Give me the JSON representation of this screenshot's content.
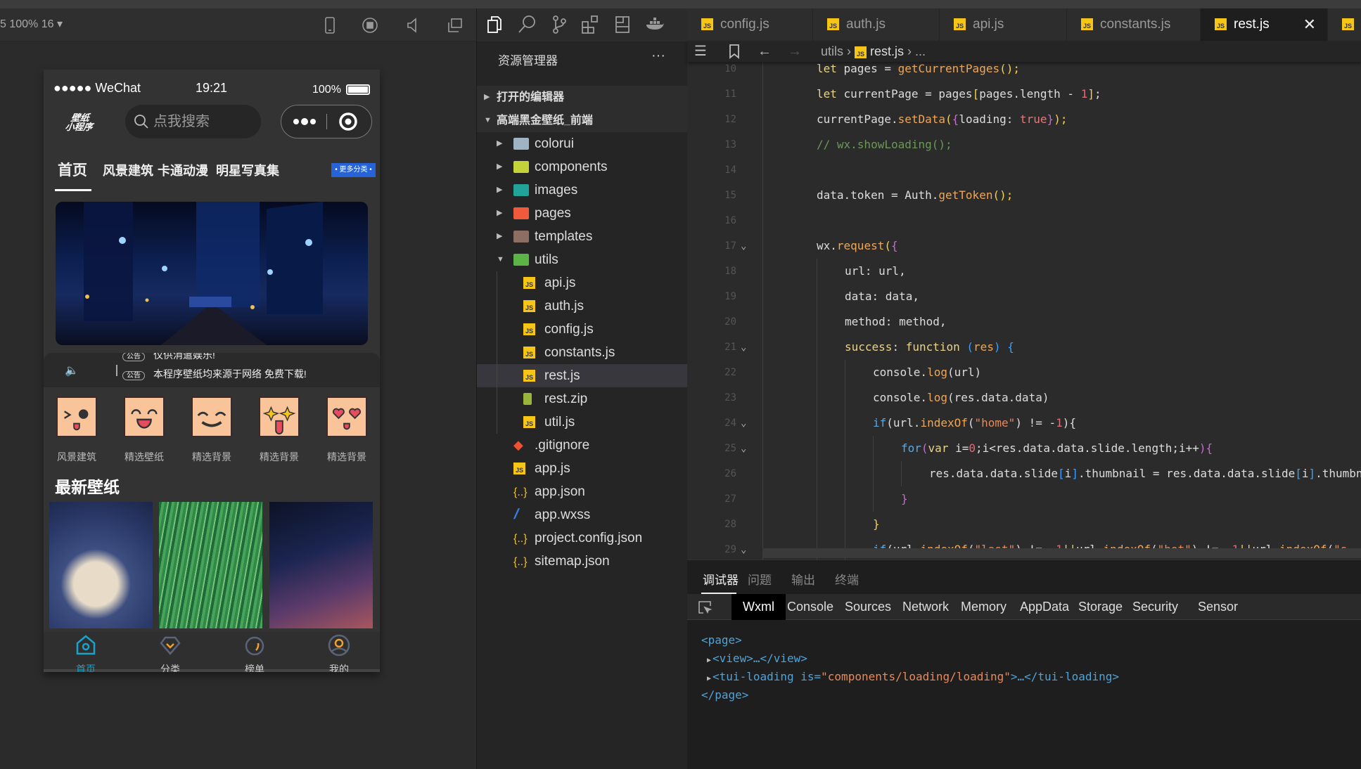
{
  "simulator": {
    "toolbar_text": "5 100% 16 ▾",
    "toolbar_icons": [
      "phone-icon",
      "stop-icon",
      "volume-icon",
      "window-icon"
    ],
    "status": {
      "carrier": "●●●●● WeChat",
      "time": "19:21",
      "battery": "100%"
    },
    "logo_text": "壁纸小程序",
    "search_placeholder": "点我搜索",
    "tabs": [
      "首页",
      "风景建筑",
      "卡通动漫",
      "明星写真集"
    ],
    "active_tab": 0,
    "more_badge": "• 更多分类 •",
    "notice": {
      "badge": "公告",
      "lines": [
        "仅供消遣娱乐!",
        "本程序壁纸均来源于网络 免费下载!"
      ]
    },
    "categories": [
      "风景建筑",
      "精选壁纸",
      "精选背景",
      "精选背景",
      "精选背景"
    ],
    "section_title": "最新壁纸",
    "bottom_nav": [
      {
        "label": "首页",
        "icon": "home-icon",
        "active": true
      },
      {
        "label": "分类",
        "icon": "category-icon",
        "active": false
      },
      {
        "label": "榜单",
        "icon": "fire-icon",
        "active": false
      },
      {
        "label": "我的",
        "icon": "user-icon",
        "active": false
      }
    ],
    "active_color": "#1aa3c8"
  },
  "explorer": {
    "title": "资源管理器",
    "more": "···",
    "sections": [
      "打开的编辑器",
      "高端黑金壁纸_前端"
    ],
    "items": [
      {
        "name": "colorui",
        "type": "folder",
        "color": "#9fb3c2",
        "depth": 1,
        "expanded": false
      },
      {
        "name": "components",
        "type": "folder",
        "color": "#c5d33a",
        "depth": 1,
        "expanded": false
      },
      {
        "name": "images",
        "type": "folder",
        "color": "#21a39a",
        "depth": 1,
        "expanded": false
      },
      {
        "name": "pages",
        "type": "folder",
        "color": "#ef5a3c",
        "depth": 1,
        "expanded": false
      },
      {
        "name": "templates",
        "type": "folder",
        "color": "#8d6e63",
        "depth": 1,
        "expanded": false
      },
      {
        "name": "utils",
        "type": "folder",
        "color": "#5cb449",
        "depth": 1,
        "expanded": true
      },
      {
        "name": "api.js",
        "type": "js",
        "depth": 2
      },
      {
        "name": "auth.js",
        "type": "js",
        "depth": 2
      },
      {
        "name": "config.js",
        "type": "js",
        "depth": 2
      },
      {
        "name": "constants.js",
        "type": "js",
        "depth": 2
      },
      {
        "name": "rest.js",
        "type": "js",
        "depth": 2,
        "selected": true
      },
      {
        "name": "rest.zip",
        "type": "zip",
        "depth": 2
      },
      {
        "name": "util.js",
        "type": "js",
        "depth": 2
      },
      {
        "name": ".gitignore",
        "type": "git",
        "depth": 1
      },
      {
        "name": "app.js",
        "type": "js",
        "depth": 1
      },
      {
        "name": "app.json",
        "type": "json",
        "depth": 1
      },
      {
        "name": "app.wxss",
        "type": "css",
        "depth": 1
      },
      {
        "name": "project.config.json",
        "type": "json",
        "depth": 1
      },
      {
        "name": "sitemap.json",
        "type": "json",
        "depth": 1
      }
    ]
  },
  "editor": {
    "tabs": [
      "config.js",
      "auth.js",
      "api.js",
      "constants.js",
      "rest.js",
      ""
    ],
    "active_tab": 4,
    "breadcrumb": [
      "utils",
      "rest.js",
      "..."
    ],
    "lines": [
      {
        "n": 10,
        "fold": false,
        "indent": 0,
        "tokens": [
          [
            "let ",
            "kw"
          ],
          [
            "pages = ",
            "pl"
          ],
          [
            "getCurrentPages",
            "fn"
          ],
          [
            "();",
            "p1"
          ]
        ]
      },
      {
        "n": 11,
        "fold": false,
        "indent": 0,
        "tokens": [
          [
            "let ",
            "kw"
          ],
          [
            "currentPage = pages",
            "pl"
          ],
          [
            "[",
            "p1"
          ],
          [
            "pages.length - ",
            "pl"
          ],
          [
            "1",
            "num"
          ],
          [
            "]",
            "p1"
          ],
          [
            ";",
            "pl"
          ]
        ]
      },
      {
        "n": 12,
        "fold": false,
        "indent": 0,
        "tokens": [
          [
            "currentPage.",
            "pl"
          ],
          [
            "setData",
            "fn"
          ],
          [
            "(",
            "p1"
          ],
          [
            "{",
            "p2"
          ],
          [
            "loading: ",
            "pl"
          ],
          [
            "true",
            "bool"
          ],
          [
            "}",
            "p2"
          ],
          [
            ");",
            "p1"
          ]
        ]
      },
      {
        "n": 13,
        "fold": false,
        "indent": 0,
        "tokens": [
          [
            "// wx.showLoading();",
            "cm"
          ]
        ]
      },
      {
        "n": 14,
        "fold": false,
        "indent": 0,
        "tokens": []
      },
      {
        "n": 15,
        "fold": false,
        "indent": 0,
        "tokens": [
          [
            "data.token = Auth.",
            "pl"
          ],
          [
            "getToken",
            "fn"
          ],
          [
            "();",
            "p1"
          ]
        ]
      },
      {
        "n": 16,
        "fold": false,
        "indent": 0,
        "tokens": []
      },
      {
        "n": 17,
        "fold": true,
        "indent": 0,
        "tokens": [
          [
            "wx.",
            "pl"
          ],
          [
            "request",
            "fn"
          ],
          [
            "(",
            "p1"
          ],
          [
            "{",
            "p2"
          ]
        ]
      },
      {
        "n": 18,
        "fold": false,
        "indent": 1,
        "tokens": [
          [
            "url: url,",
            "pl"
          ]
        ]
      },
      {
        "n": 19,
        "fold": false,
        "indent": 1,
        "tokens": [
          [
            "data: data,",
            "pl"
          ]
        ]
      },
      {
        "n": 20,
        "fold": false,
        "indent": 1,
        "tokens": [
          [
            "method: method,",
            "pl"
          ]
        ]
      },
      {
        "n": 21,
        "fold": true,
        "indent": 1,
        "tokens": [
          [
            "success",
            "kw"
          ],
          [
            ": ",
            "pl"
          ],
          [
            "function ",
            "kw"
          ],
          [
            "(",
            "p3"
          ],
          [
            "res",
            "fn"
          ],
          [
            ") ",
            "p3"
          ],
          [
            "{",
            "p3"
          ]
        ]
      },
      {
        "n": 22,
        "fold": false,
        "indent": 2,
        "tokens": [
          [
            "console.",
            "pl"
          ],
          [
            "log",
            "fn"
          ],
          [
            "(url)",
            "pl"
          ]
        ]
      },
      {
        "n": 23,
        "fold": false,
        "indent": 2,
        "tokens": [
          [
            "console.",
            "pl"
          ],
          [
            "log",
            "fn"
          ],
          [
            "(res.data.data)",
            "pl"
          ]
        ]
      },
      {
        "n": 24,
        "fold": true,
        "indent": 2,
        "tokens": [
          [
            "if",
            "bl"
          ],
          [
            "(url.",
            "pl"
          ],
          [
            "indexOf",
            "fn"
          ],
          [
            "(",
            "pl"
          ],
          [
            "\"home\"",
            "str"
          ],
          [
            ") != -",
            "pl"
          ],
          [
            "1",
            "num"
          ],
          [
            "){",
            "pl"
          ]
        ]
      },
      {
        "n": 25,
        "fold": true,
        "indent": 3,
        "tokens": [
          [
            "for",
            "bl"
          ],
          [
            "(",
            "p2"
          ],
          [
            "var ",
            "kw"
          ],
          [
            "i=",
            "pl"
          ],
          [
            "0",
            "num"
          ],
          [
            ";i<res.data.data.slide.length;i++",
            "pl"
          ],
          [
            "){",
            "p2"
          ]
        ]
      },
      {
        "n": 26,
        "fold": false,
        "indent": 4,
        "tokens": [
          [
            "res.data.data.slide",
            "pl"
          ],
          [
            "[",
            "p3"
          ],
          [
            "i",
            "pl"
          ],
          [
            "]",
            "p3"
          ],
          [
            ".thumbnail = res.data.data.slide",
            "pl"
          ],
          [
            "[",
            "p3"
          ],
          [
            "i",
            "pl"
          ],
          [
            "]",
            "p3"
          ],
          [
            ".thumbnail",
            "pl"
          ]
        ]
      },
      {
        "n": 27,
        "fold": false,
        "indent": 3,
        "tokens": [
          [
            "}",
            "p2"
          ]
        ]
      },
      {
        "n": 28,
        "fold": false,
        "indent": 2,
        "tokens": [
          [
            "}",
            "p1"
          ]
        ]
      },
      {
        "n": 29,
        "fold": true,
        "indent": 2,
        "tokens": [
          [
            "if",
            "bl"
          ],
          [
            "(url.",
            "pl"
          ],
          [
            "indexOf",
            "fn"
          ],
          [
            "(",
            "pl"
          ],
          [
            "\"last\"",
            "str"
          ],
          [
            ") != -",
            "pl"
          ],
          [
            "1",
            "num"
          ],
          [
            "||",
            "p1"
          ],
          [
            "url.",
            "pl"
          ],
          [
            "indexOf",
            "fn"
          ],
          [
            "(",
            "pl"
          ],
          [
            "\"hot\"",
            "str"
          ],
          [
            ") != -",
            "pl"
          ],
          [
            "1",
            "num"
          ],
          [
            "||",
            "p1"
          ],
          [
            "url.",
            "pl"
          ],
          [
            "indexOf",
            "fn"
          ],
          [
            "(",
            "pl"
          ],
          [
            "\"s",
            "str"
          ]
        ]
      }
    ]
  },
  "debug": {
    "tabs": [
      "调试器",
      "问题",
      "输出",
      "终端"
    ],
    "active_tab": 0,
    "devtools_tabs": [
      "Wxml",
      "Console",
      "Sources",
      "Network",
      "Memory",
      "AppData",
      "Storage",
      "Security",
      "Sensor"
    ],
    "active_devtool": 0,
    "wxml": [
      {
        "text": "<page>",
        "expandable": false,
        "indent": 0
      },
      {
        "text": "<view>…</view>",
        "expandable": true,
        "indent": 1
      },
      {
        "text": "<tui-loading is=\"components/loading/loading\">…</tui-loading>",
        "expandable": true,
        "indent": 1
      },
      {
        "text": "</page>",
        "expandable": false,
        "indent": 0
      }
    ]
  }
}
